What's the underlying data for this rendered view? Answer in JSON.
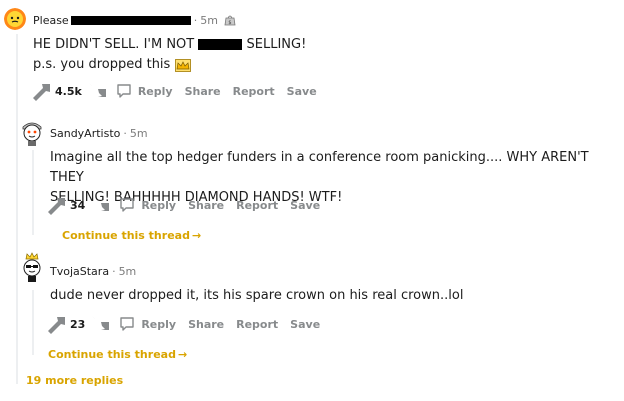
{
  "comments": [
    {
      "author": "Please",
      "time": "5m",
      "line1_a": "HE DIDN'T SELL. I'M NOT ",
      "line1_b": " SELLING!",
      "line2": "p.s. you dropped this",
      "score": "4.5k",
      "award_icon": "bag-award-icon",
      "inline_icon": "crown-emoji-icon"
    },
    {
      "author": "SandyArtisto",
      "time": "5m",
      "line1": "Imagine all the top hedger funders in a conference room panicking.... WHY AREN'T THEY",
      "line2": "SELLING! BAHHHHH DIAMOND HANDS! WTF!",
      "score": "34",
      "continue": "Continue this thread"
    },
    {
      "author": "TvojaStara",
      "time": "5m",
      "line1": "dude never dropped it, its his spare crown on his real crown..lol",
      "score": "23",
      "continue": "Continue this thread"
    }
  ],
  "actions": {
    "reply": "Reply",
    "share": "Share",
    "report": "Report",
    "save": "Save"
  },
  "more_replies": "19 more replies",
  "colors": {
    "link_yellow": "#d9a400",
    "meta_gray": "#7c7c7c",
    "action_gray": "#878a8c"
  }
}
